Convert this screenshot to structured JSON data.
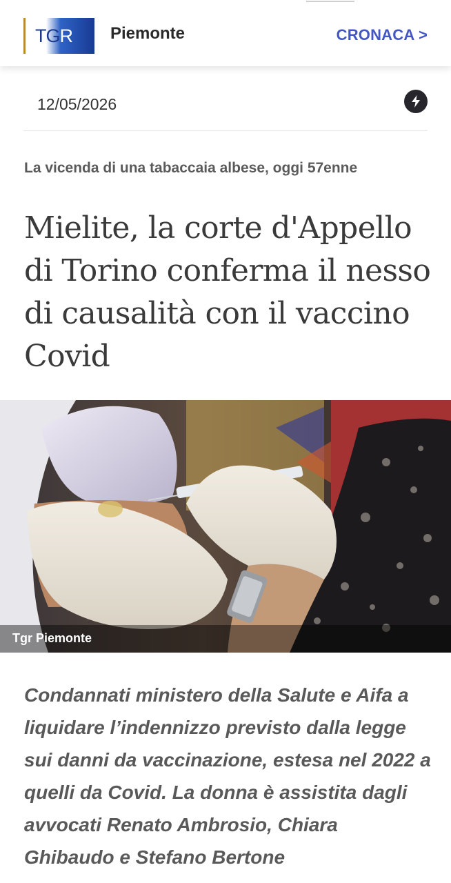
{
  "header": {
    "logo_text": "TGR",
    "region": "Piemonte",
    "section_link": "CRONACA >"
  },
  "article": {
    "date": "12/05/2026",
    "kicker": "La vicenda di una tabaccaia albese, oggi 57enne",
    "headline": "Mielite, la corte d'Appello di Torino conferma il nesso di causalità con il vaccino Covid",
    "photo_caption": "Tgr Piemonte",
    "summary": "Condannati ministero della Salute e Aifa a liquidare l’indennizzo previsto dalla legge sui danni da vaccinazione, estesa nel 2022 a quelli da Covid. La donna è assistita dagli avvocati Renato Ambrosio, Chiara Ghibaudo e Stefano Bertone"
  },
  "icons": {
    "flash": "lightning-icon"
  },
  "colors": {
    "accent": "#4356c4",
    "logo_blue": "#1b3a8c",
    "logo_gold": "#b8892e",
    "text_dark": "#3a3a3a"
  }
}
